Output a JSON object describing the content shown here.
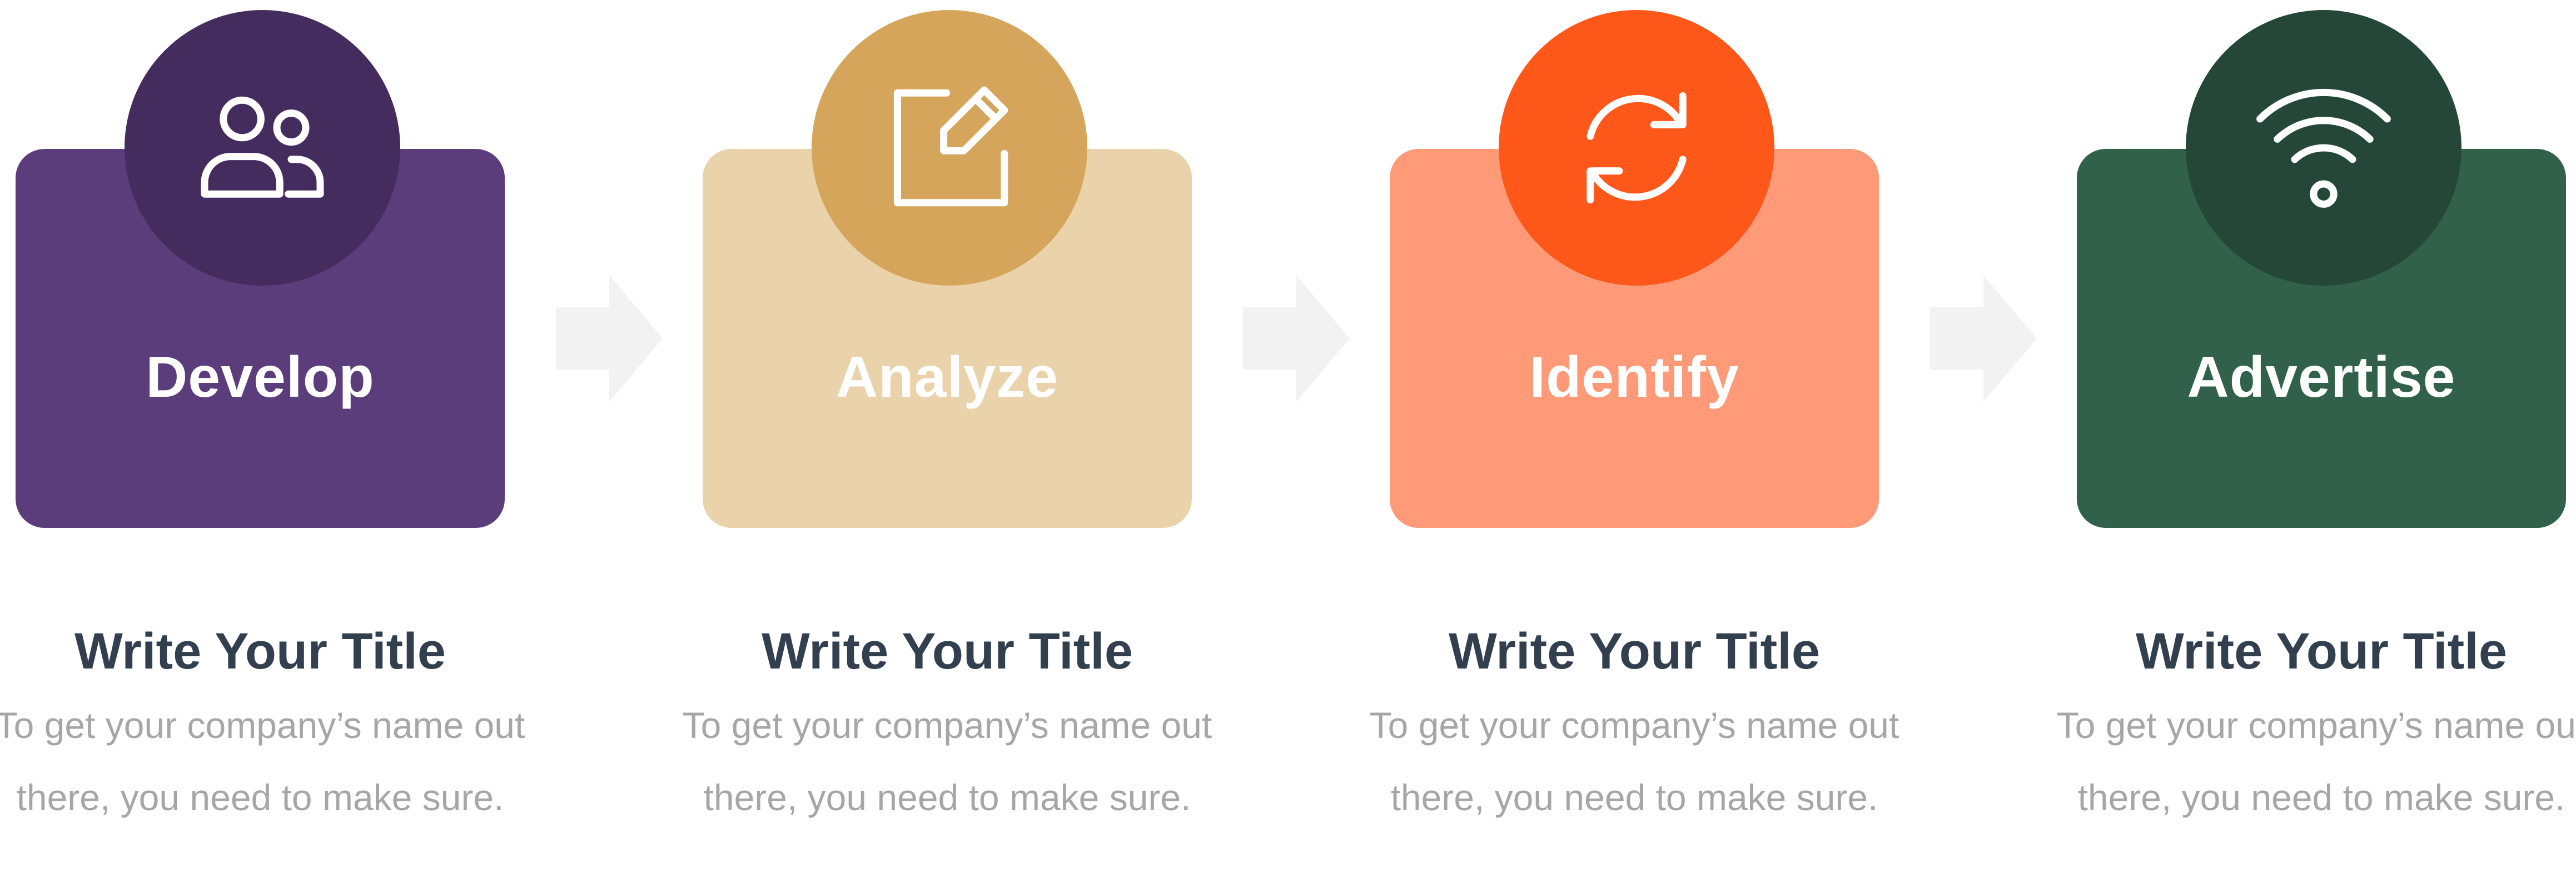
{
  "steps": [
    {
      "label": "Develop",
      "icon": "users-icon",
      "card_color": "#5c3d7b",
      "circle_color": "#452c5e",
      "title": "Write Your Title",
      "description": "To get your company’s name out there, you need to make sure."
    },
    {
      "label": "Analyze",
      "icon": "edit-icon",
      "card_color": "#ead3ab",
      "circle_color": "#d4a55a",
      "title": "Write Your Title",
      "description": "To get your company’s name out there, you need to make sure."
    },
    {
      "label": "Identify",
      "icon": "refresh-icon",
      "card_color": "#fe9a78",
      "circle_color": "#fd571a",
      "title": "Write Your Title",
      "description": "To get your company’s name out there, you need to make sure."
    },
    {
      "label": "Advertise",
      "icon": "wifi-icon",
      "card_color": "#31614b",
      "circle_color": "#244737",
      "title": "Write Your Title",
      "description": "To get your company’s name out there, you need to make sure."
    }
  ],
  "arrow_color": "#f2f2f2"
}
